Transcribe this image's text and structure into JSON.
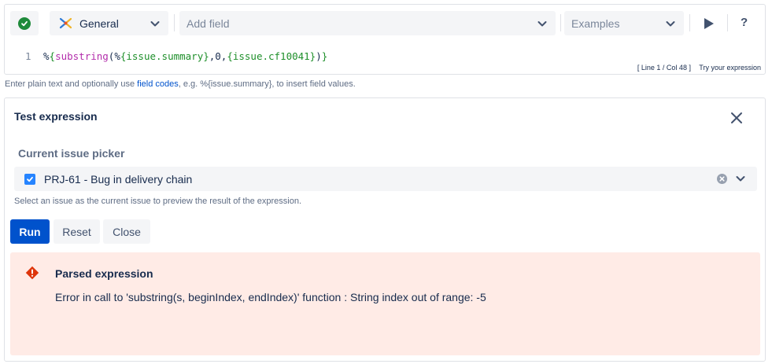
{
  "toolbar": {
    "category_select": {
      "value": "General",
      "icon": "app-logo-icon"
    },
    "field_select": {
      "placeholder": "Add field"
    },
    "examples_select": {
      "placeholder": "Examples"
    },
    "help_label": "?"
  },
  "editor": {
    "line_number": "1",
    "tokens": {
      "t1": "%",
      "t2": "{",
      "t3": "substring",
      "t4": "(",
      "t5": "%",
      "t6": "{issue.summary}",
      "t7": ",0,",
      "t8": "{issue.cf10041}",
      "t9": ")",
      "t10": "}"
    },
    "cursor_position": "[ Line 1 / Col 48 ]",
    "try_link": "Try your expression"
  },
  "hint": {
    "before": "Enter plain text and optionally use ",
    "link": "field codes",
    "after": ", e.g. %{issue.summary}, to insert field values."
  },
  "test_panel": {
    "title": "Test expression",
    "picker_label": "Current issue picker",
    "picker_value": "PRJ-61 - Bug in delivery chain",
    "picker_help": "Select an issue as the current issue to preview the result of the expression.",
    "buttons": {
      "run": "Run",
      "reset": "Reset",
      "close": "Close"
    },
    "error": {
      "title": "Parsed expression",
      "message": "Error in call to 'substring(s, beginIndex, endIndex)' function : String index out of range: -5"
    }
  },
  "colors": {
    "primary": "#0052cc",
    "valid_green": "#1f8a3b",
    "error_bg": "#ffebe6",
    "error_icon": "#de350b",
    "checkbox": "#2684ff"
  }
}
